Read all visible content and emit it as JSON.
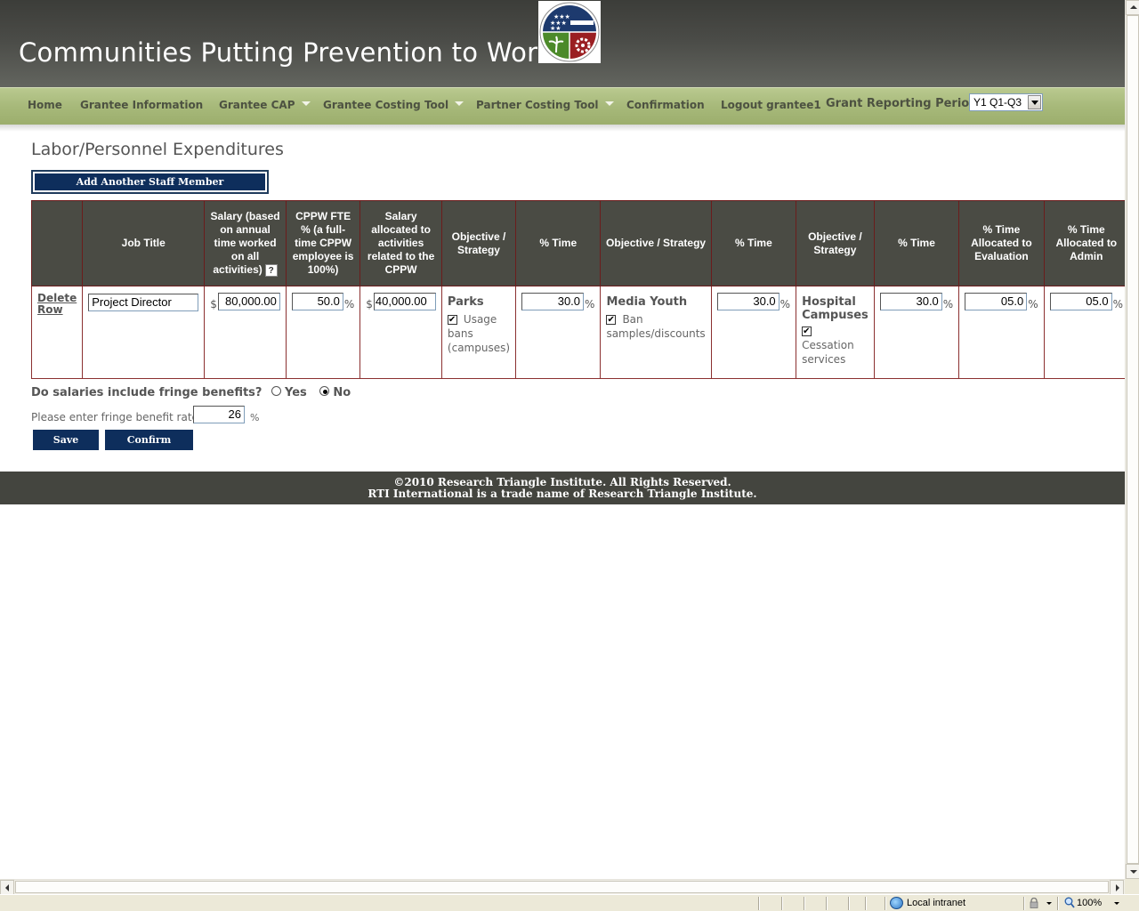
{
  "header": {
    "site_title": "Communities Putting Prevention to Work",
    "logo_icon": "recovery-gov-seal-icon"
  },
  "nav": {
    "items": [
      {
        "label": "Home"
      },
      {
        "label": "Grantee Information"
      },
      {
        "label": "Grantee CAP"
      },
      {
        "label": "Grantee Costing Tool"
      },
      {
        "label": "Partner Costing Tool"
      },
      {
        "label": "Confirmation"
      },
      {
        "label": "Logout grantee1"
      }
    ],
    "period_label": "Grant Reporting Period:",
    "period_value": "Y1 Q1-Q3"
  },
  "page": {
    "heading": "Labor/Personnel Expenditures",
    "add_staff_label": "Add Another Staff Member"
  },
  "table": {
    "headers": [
      "",
      "Job Title",
      "Salary (based on annual time worked on all activities)",
      "CPPW FTE % (a full-time CPPW employee is 100%)",
      "Salary allocated to activities related to the CPPW",
      "Objective / Strategy",
      "% Time",
      "Objective / Strategy",
      "% Time",
      "Objective / Strategy",
      "% Time",
      "% Time Allocated to Evaluation",
      "% Time Allocated to Admin"
    ],
    "help_icon_label": "?",
    "row": {
      "delete_label": "Delete Row",
      "job_title": "Project Director",
      "currency": "$",
      "salary": "80,000.00",
      "fte": "50.0",
      "allocated_salary": "40,000.00",
      "pct_sign": "%",
      "objectives": [
        {
          "title": "Parks",
          "strategy": "Usage bans (campuses)",
          "checked": true,
          "time": "30.0"
        },
        {
          "title": "Media Youth",
          "strategy": "Ban samples/discounts",
          "checked": true,
          "time": "30.0"
        },
        {
          "title": "Hospital Campuses",
          "strategy": "Cessation services",
          "checked": true,
          "time": "30.0"
        }
      ],
      "evaluation": "05.0",
      "admin": "05.0"
    }
  },
  "fringe": {
    "question": "Do salaries include fringe benefits?",
    "yes_label": "Yes",
    "no_label": "No",
    "selected": "No",
    "rate_label": "Please enter fringe benefit rate",
    "rate_value": "26",
    "rate_unit": "%"
  },
  "buttons": {
    "save": "Save",
    "confirm": "Confirm"
  },
  "footer": {
    "line1": "©2010 Research Triangle Institute. All Rights Reserved.",
    "line2": "RTI International is a trade name of Research Triangle Institute."
  },
  "statusbar": {
    "zone": "Local intranet",
    "zoom": "100%"
  },
  "colors": {
    "header_dark": "#3c3d39",
    "nav_green": "#a7b97a",
    "button_navy": "#0e2e5c",
    "table_header": "#4a4b44",
    "table_border": "#8b3030",
    "footer": "#44453f"
  }
}
